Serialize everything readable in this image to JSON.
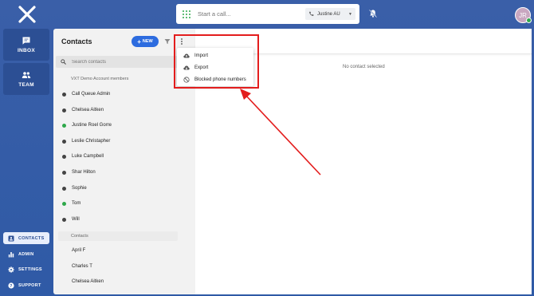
{
  "topbar": {
    "call_placeholder": "Start a call...",
    "caller_id": "Justine AU",
    "avatar_initials": "JR"
  },
  "nav": {
    "inbox": "INBOX",
    "team": "TEAM",
    "contacts": "CONTACTS",
    "admin": "ADMIN",
    "settings": "SETTINGS",
    "support": "SUPPORT"
  },
  "contacts_panel": {
    "title": "Contacts",
    "new_label": "NEW",
    "search_placeholder": "Search contacts",
    "group_members": "VXT Demo Account members",
    "members": [
      {
        "name": "Call Queue Admin",
        "status": "offline"
      },
      {
        "name": "Chelsea Aitken",
        "status": "offline"
      },
      {
        "name": "Justine Roel Gorre",
        "status": "online"
      },
      {
        "name": "Leslie Christapher",
        "status": "offline"
      },
      {
        "name": "Luke Campbell",
        "status": "offline"
      },
      {
        "name": "Shar Hilton",
        "status": "offline"
      },
      {
        "name": "Sophie",
        "status": "offline"
      },
      {
        "name": "Tom",
        "status": "online"
      },
      {
        "name": "Will",
        "status": "offline"
      }
    ],
    "group_contacts": "Contacts",
    "contacts": [
      "April F",
      "Charles T",
      "Chelsea Aitken"
    ]
  },
  "main": {
    "empty_text": "No contact selected"
  },
  "menu": {
    "import": "Import",
    "export": "Export",
    "blocked": "Blocked phone numbers"
  },
  "colors": {
    "brand_blue": "#2f5aa6",
    "accent": "#2d6cdf",
    "online": "#2ea84a",
    "annotation_red": "#e31d1d"
  }
}
